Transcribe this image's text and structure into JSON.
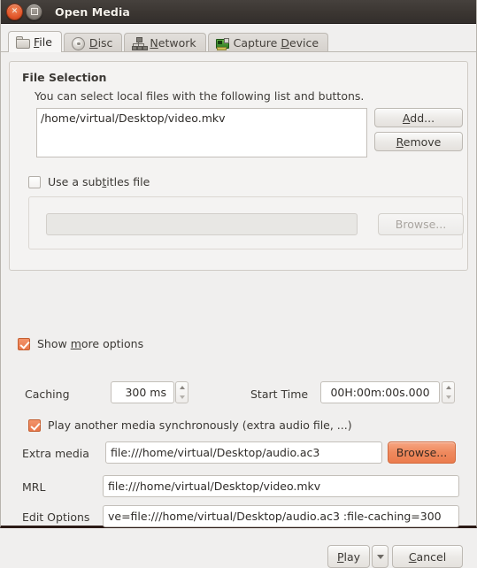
{
  "window": {
    "title": "Open Media",
    "close_icon": "close-icon",
    "maximize_icon": "maximize-icon"
  },
  "tabs": [
    {
      "label": "File",
      "accel": "F",
      "icon": "folder-icon",
      "active": true
    },
    {
      "label": "Disc",
      "accel": "D",
      "icon": "disc-icon",
      "active": false
    },
    {
      "label": "Network",
      "accel": "N",
      "icon": "network-icon",
      "active": false
    },
    {
      "label": "Capture Device",
      "accel": "D",
      "icon": "capture-card-icon",
      "active": false
    }
  ],
  "file_selection": {
    "title": "File Selection",
    "description": "You can select local files with the following list and buttons.",
    "files": [
      "/home/virtual/Desktop/video.mkv"
    ],
    "add_label": "Add...",
    "remove_label": "Remove"
  },
  "subtitles": {
    "checkbox_label": "Use a subtitles file",
    "checked": false,
    "path_value": "",
    "browse_label": "Browse...",
    "enabled": false
  },
  "show_more_options": {
    "label": "Show more options",
    "checked": true
  },
  "caching": {
    "label": "Caching",
    "value": "300 ms"
  },
  "start_time": {
    "label": "Start Time",
    "value": "00H:00m:00s.000"
  },
  "sync_media": {
    "label": "Play another media synchronously (extra audio file, ...)",
    "checked": true
  },
  "extra_media": {
    "label": "Extra media",
    "value": "file:///home/virtual/Desktop/audio.ac3",
    "browse_label": "Browse..."
  },
  "mrl": {
    "label": "MRL",
    "value": "file:///home/virtual/Desktop/video.mkv"
  },
  "edit_options": {
    "label": "Edit Options",
    "value": "ve=file:///home/virtual/Desktop/audio.ac3 :file-caching=300"
  },
  "footer": {
    "play_label": "Play",
    "play_menu_icon": "chevron-down-icon",
    "cancel_label": "Cancel"
  },
  "colors": {
    "titlebar": "#3b3632",
    "accent_orange": "#ef8a5e",
    "checkbox_checked": "#e9764a",
    "window_bg": "#f0efee",
    "field_bg": "#ffffff",
    "disabled_field_bg": "#e8e7e4"
  }
}
